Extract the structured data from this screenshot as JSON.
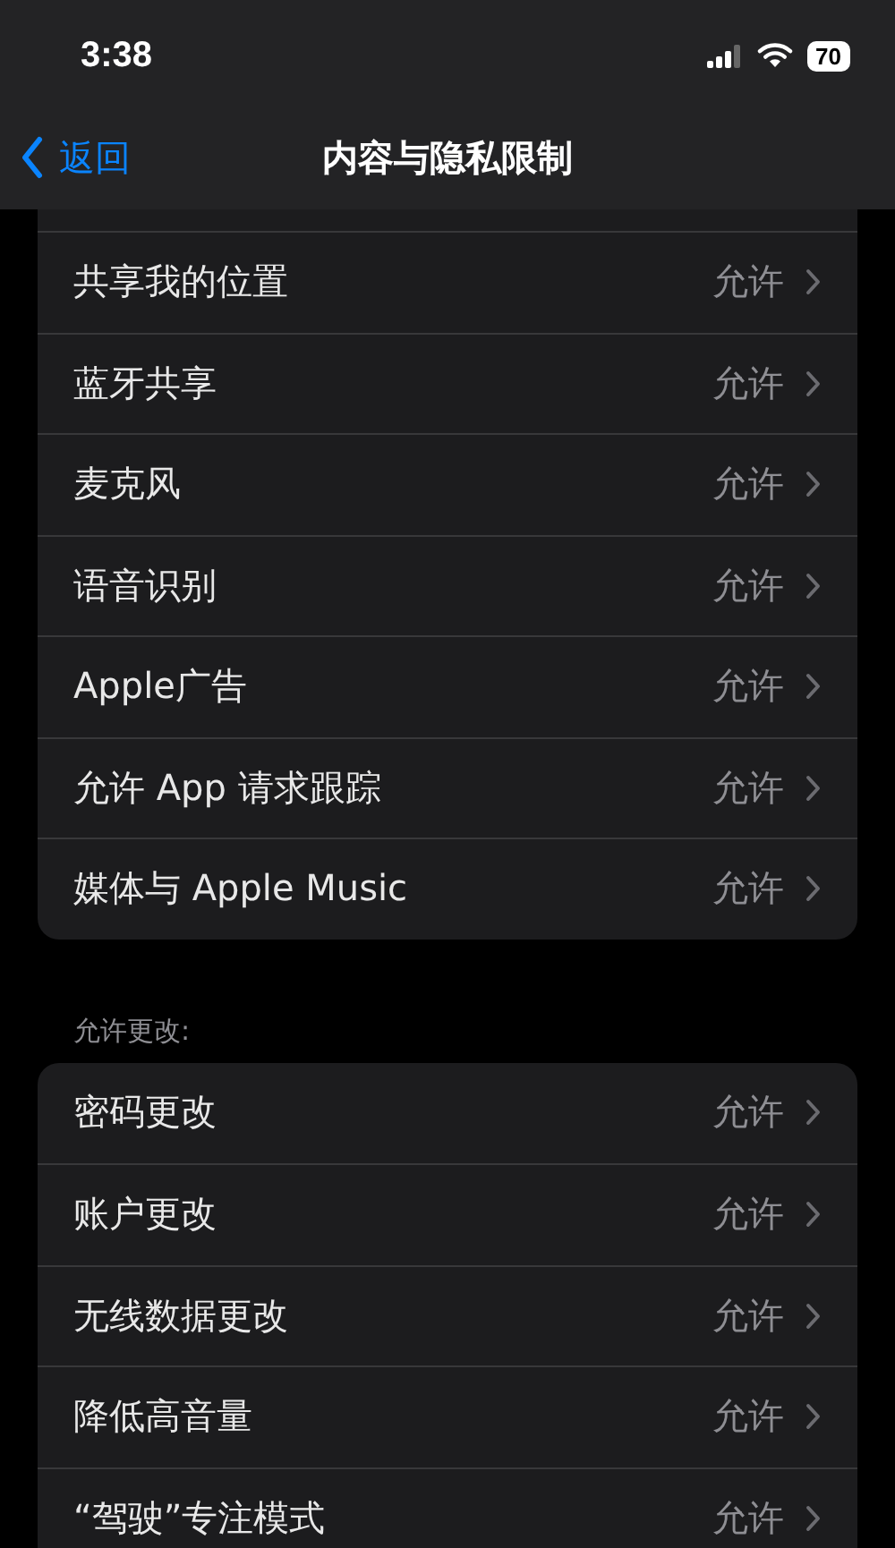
{
  "status_bar": {
    "time": "3:38",
    "battery": "70"
  },
  "nav": {
    "back": "返回",
    "title": "内容与隐私限制"
  },
  "sections": [
    {
      "rows": [
        {
          "label": "共享我的位置",
          "value": "允许"
        },
        {
          "label": "蓝牙共享",
          "value": "允许"
        },
        {
          "label": "麦克风",
          "value": "允许"
        },
        {
          "label": "语音识别",
          "value": "允许"
        },
        {
          "label": "Apple广告",
          "value": "允许"
        },
        {
          "label": "允许 App 请求跟踪",
          "value": "允许"
        },
        {
          "label": "媒体与 Apple Music",
          "value": "允许"
        }
      ]
    },
    {
      "header": "允许更改:",
      "rows": [
        {
          "label": "密码更改",
          "value": "允许"
        },
        {
          "label": "账户更改",
          "value": "允许"
        },
        {
          "label": "无线数据更改",
          "value": "允许"
        },
        {
          "label": "降低高音量",
          "value": "允许"
        },
        {
          "label": "“驾驶”专注模式",
          "value": "允许"
        }
      ]
    }
  ]
}
